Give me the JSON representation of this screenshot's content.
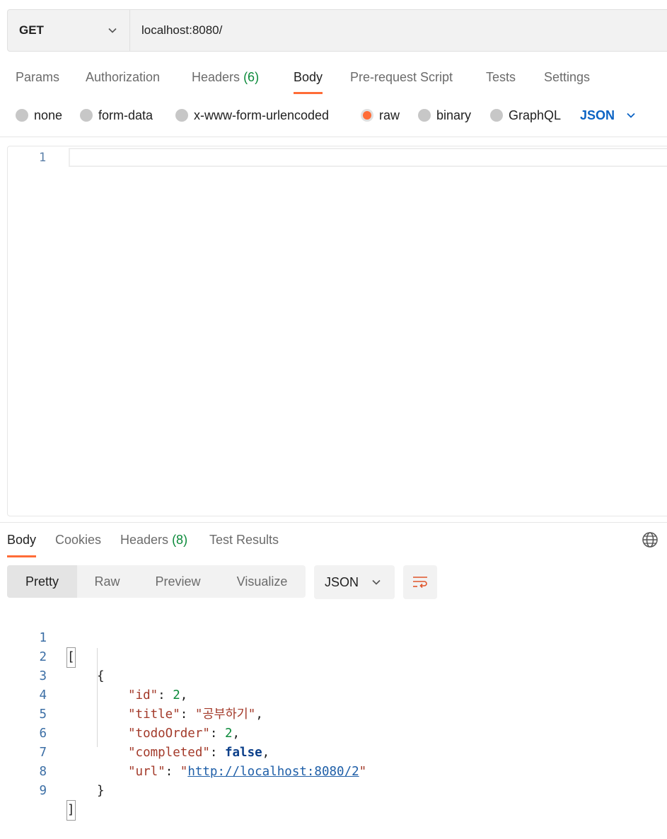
{
  "request": {
    "method": "GET",
    "url": "localhost:8080/"
  },
  "request_tabs": [
    {
      "label": "Params"
    },
    {
      "label": "Authorization"
    },
    {
      "label": "Headers",
      "count": "(6)"
    },
    {
      "label": "Body",
      "active": true
    },
    {
      "label": "Pre-request Script"
    },
    {
      "label": "Tests"
    },
    {
      "label": "Settings"
    }
  ],
  "body_types": [
    {
      "label": "none"
    },
    {
      "label": "form-data"
    },
    {
      "label": "x-www-form-urlencoded"
    },
    {
      "label": "raw",
      "selected": true
    },
    {
      "label": "binary"
    },
    {
      "label": "GraphQL"
    }
  ],
  "raw_language": "JSON",
  "request_editor": {
    "line_numbers": [
      "1"
    ]
  },
  "response_tabs": [
    {
      "label": "Body",
      "active": true
    },
    {
      "label": "Cookies"
    },
    {
      "label": "Headers",
      "count": "(8)"
    },
    {
      "label": "Test Results"
    }
  ],
  "view_modes": [
    {
      "label": "Pretty",
      "active": true
    },
    {
      "label": "Raw"
    },
    {
      "label": "Preview"
    },
    {
      "label": "Visualize"
    }
  ],
  "response_format": "JSON",
  "response_body": {
    "line_numbers": [
      "1",
      "2",
      "3",
      "4",
      "5",
      "6",
      "7",
      "8",
      "9"
    ],
    "open_bracket": "[",
    "open_brace": "{",
    "fields": [
      {
        "key": "\"id\"",
        "value": "2",
        "value_type": "number",
        "trail": ","
      },
      {
        "key": "\"title\"",
        "value": "\"공부하기\"",
        "value_type": "string",
        "trail": ","
      },
      {
        "key": "\"todoOrder\"",
        "value": "2",
        "value_type": "number",
        "trail": ","
      },
      {
        "key": "\"completed\"",
        "value": "false",
        "value_type": "boolean",
        "trail": ","
      },
      {
        "key": "\"url\"",
        "value_prefix": "\"",
        "value_link": "http://localhost:8080/2",
        "value_suffix": "\"",
        "value_type": "link",
        "trail": ""
      }
    ],
    "close_brace": "}",
    "close_bracket": "]"
  },
  "colors": {
    "accent": "#ff6c37",
    "count_green": "#0b8a3a",
    "link_blue": "#0b63c4"
  },
  "icons": {
    "method_dropdown": "chevron-down-icon",
    "language_dropdown": "chevron-down-icon",
    "globe": "globe-icon",
    "wrap": "wrap-lines-icon"
  }
}
